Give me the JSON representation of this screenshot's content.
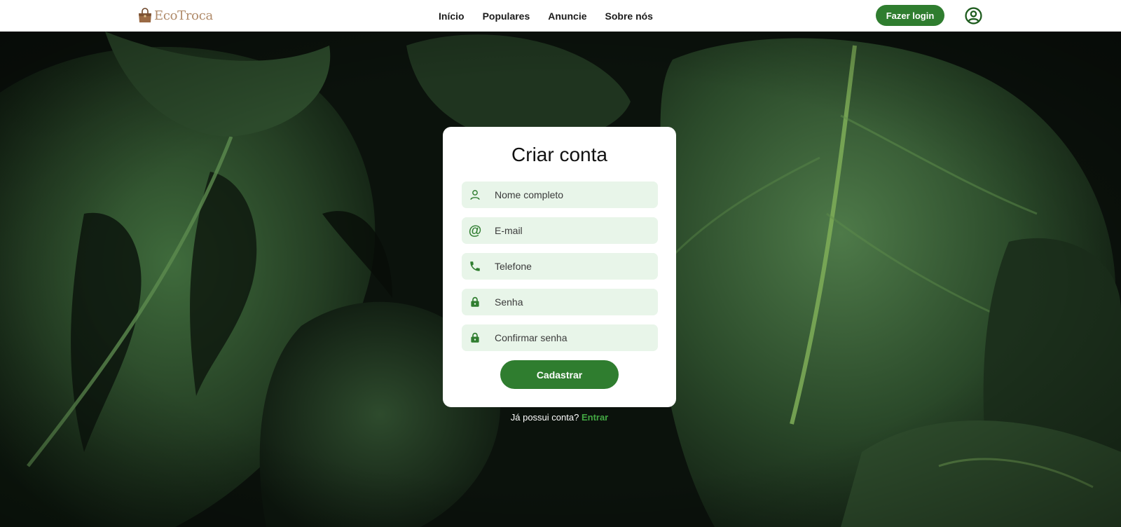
{
  "header": {
    "logo_text": "EcoTroca",
    "nav": [
      "Início",
      "Populares",
      "Anuncie",
      "Sobre nós"
    ],
    "login_label": "Fazer login"
  },
  "form": {
    "title": "Criar conta",
    "fields": [
      {
        "placeholder": "Nome completo",
        "icon": "user-icon"
      },
      {
        "placeholder": "E-mail",
        "icon": "at-icon"
      },
      {
        "placeholder": "Telefone",
        "icon": "phone-icon"
      },
      {
        "placeholder": "Senha",
        "icon": "lock-icon"
      },
      {
        "placeholder": "Confirmar senha",
        "icon": "lock-icon"
      }
    ],
    "submit_label": "Cadastrar",
    "footer_text": "Já possui conta?",
    "footer_link": "Entrar"
  },
  "colors": {
    "accent": "#2f7d2f",
    "field_bg": "#e8f5e9",
    "link": "#43a843",
    "logo": "#b08b6a"
  }
}
